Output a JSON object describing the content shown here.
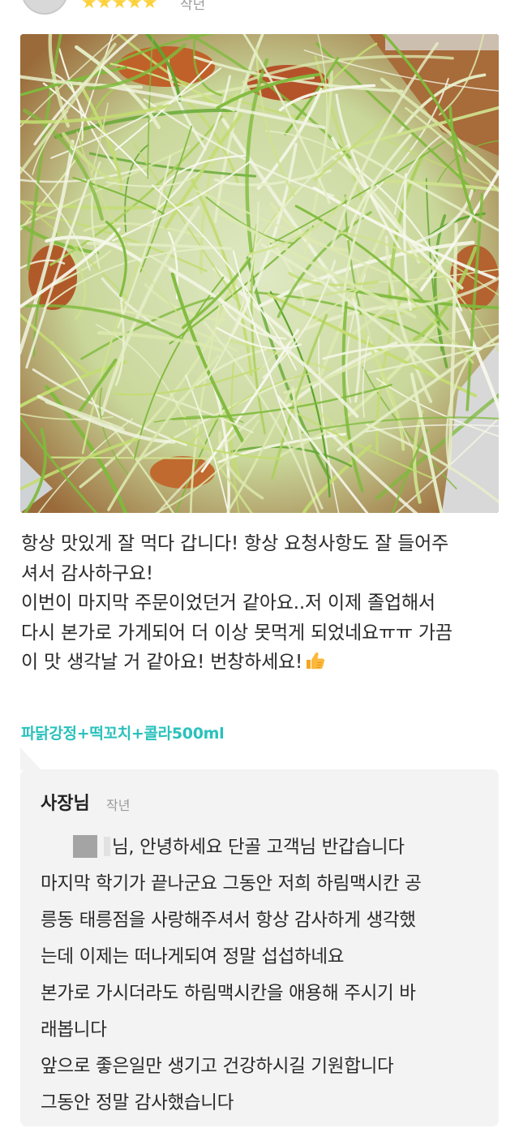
{
  "review": {
    "rating": 5,
    "stars": "★★★★★",
    "date": "작년",
    "text_lines": [
      "항상 맛있게 잘 먹다 갑니다! 항상 요청사항도 잘 들어주",
      "셔서 감사하구요!",
      "이번이 마지막 주문이었던거 같아요..저 이제 졸업해서",
      "다시 본가로 가게되어 더 이상 못먹게 되었네요ㅠㅠ 가끔",
      "이 맛 생각날 거 같아요! 번창하세요!"
    ],
    "emoji_icon": "thumbs-up-icon",
    "menu": "파닭강정+떡꼬치+콜라500ml"
  },
  "owner_reply": {
    "name": "사장님",
    "date": "작년",
    "lines": [
      "님, 안녕하세요 단골 고객님 반갑습니다",
      "마지막 학기가 끝나군요 그동안 저희 하림맥시칸 공",
      "릉동 태릉점을 사랑해주셔서 항상 감사하게 생각했",
      "는데 이제는 떠나게되여 정말 섭섭하네요",
      "본가로 가시더라도 하림맥시칸을 애용해 주시기 바",
      "래봅니다",
      "앞으로 좋은일만 생기고 건강하시길 기원합니다",
      "그동안 정말 감사했습니다"
    ]
  },
  "colors": {
    "star": "#fcd13b",
    "menu_tag": "#2ac1bc",
    "reply_bg": "#f3f3f3",
    "meta_text": "#9a9a9a"
  }
}
